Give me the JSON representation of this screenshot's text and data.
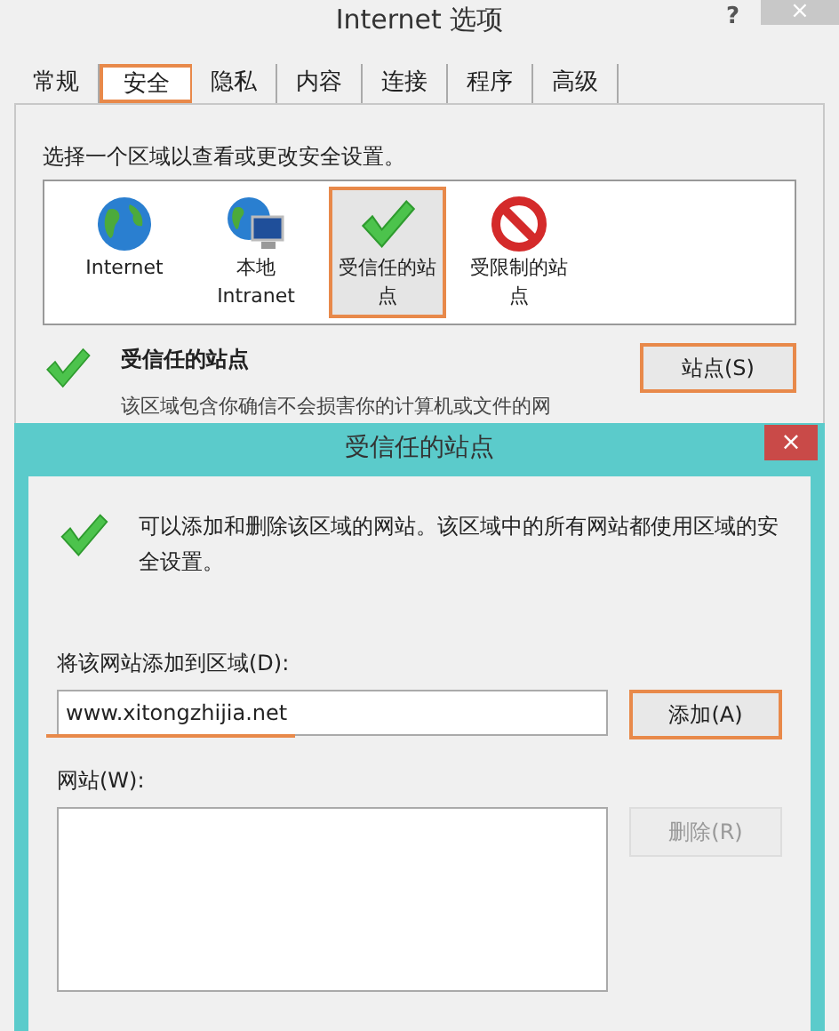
{
  "window": {
    "title": "Internet 选项",
    "help": "?",
    "close": "×"
  },
  "tabs": [
    {
      "label": "常规",
      "selected": false,
      "highlighted": false
    },
    {
      "label": "安全",
      "selected": true,
      "highlighted": true
    },
    {
      "label": "隐私",
      "selected": false,
      "highlighted": false
    },
    {
      "label": "内容",
      "selected": false,
      "highlighted": false
    },
    {
      "label": "连接",
      "selected": false,
      "highlighted": false
    },
    {
      "label": "程序",
      "selected": false,
      "highlighted": false
    },
    {
      "label": "高级",
      "selected": false,
      "highlighted": false
    }
  ],
  "zone_prompt": "选择一个区域以查看或更改安全设置。",
  "zones": [
    {
      "kind": "globe",
      "label": "Internet",
      "selected": false,
      "highlighted": false
    },
    {
      "kind": "intranet",
      "label": "本地\nIntranet",
      "selected": false,
      "highlighted": false
    },
    {
      "kind": "trusted",
      "label": "受信任的站点",
      "selected": true,
      "highlighted": true
    },
    {
      "kind": "restricted",
      "label": "受限制的站点",
      "selected": false,
      "highlighted": false
    }
  ],
  "zone_info": {
    "title": "受信任的站点",
    "description": "该区域包含你确信不会损害你的计算机或文件的网",
    "button": {
      "label": "站点(S)",
      "highlighted": true
    }
  },
  "dialog": {
    "title": "受信任的站点",
    "close": "×",
    "intro": "可以添加和删除该区域的网站。该区域中的所有网站都使用区域的安全设置。",
    "add_label": "将该网站添加到区域(D):",
    "add_value": "www.xitongzhijia.net",
    "add_value_underlined": true,
    "add_button": {
      "label": "添加(A)",
      "highlighted": true,
      "disabled": false
    },
    "list_label": "网站(W):",
    "remove_button": {
      "label": "删除(R)",
      "highlighted": false,
      "disabled": true
    }
  }
}
